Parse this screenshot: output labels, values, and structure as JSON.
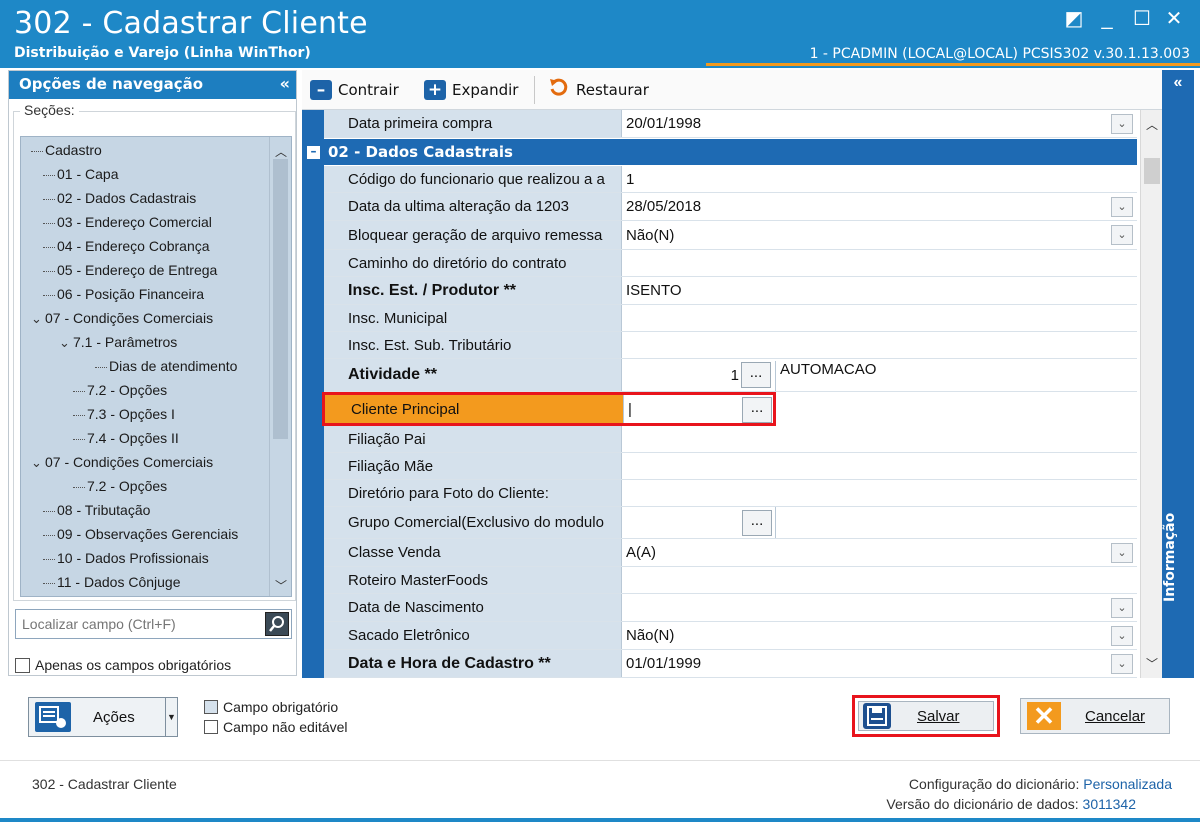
{
  "window": {
    "title": "302 - Cadastrar Cliente",
    "subtitle": "Distribuição e Varejo (Linha WinThor)",
    "user_info": "1 - PCADMIN (LOCAL@LOCAL)  PCSIS302  v.30.1.13.003",
    "controls": {
      "restore": "◩",
      "minimize": "_",
      "maximize": "☐",
      "close": "✕"
    }
  },
  "colors": {
    "title_bar": "#1e88c7",
    "panel_blue": "#1e6ab3",
    "highlight_orange": "#f39a1e",
    "highlight_border": "#e8141c"
  },
  "nav": {
    "header": "Opções de navegação",
    "collapse_glyph": "«",
    "sections_label": "Seções:",
    "items": [
      {
        "label": "Cadastro"
      },
      {
        "label": "01 - Capa"
      },
      {
        "label": "02 - Dados Cadastrais"
      },
      {
        "label": "03 - Endereço Comercial"
      },
      {
        "label": "04 - Endereço Cobrança"
      },
      {
        "label": "05 - Endereço de Entrega"
      },
      {
        "label": "06 - Posição Financeira"
      },
      {
        "label": "07 - Condições Comerciais"
      },
      {
        "label": "7.1 - Parâmetros"
      },
      {
        "label": "Dias de atendimento"
      },
      {
        "label": "7.2 - Opções"
      },
      {
        "label": "7.3 - Opções I"
      },
      {
        "label": "7.4 - Opções II"
      },
      {
        "label": "07 - Condições Comerciais"
      },
      {
        "label": "7.2 - Opções"
      },
      {
        "label": "08 - Tributação"
      },
      {
        "label": "09 - Observações Gerenciais"
      },
      {
        "label": "10 - Dados Profissionais"
      },
      {
        "label": "11 - Dados Cônjuge"
      }
    ],
    "search_placeholder": "Localizar campo (Ctrl+F)",
    "only_required_label": "Apenas os campos obrigatórios"
  },
  "toolbar": {
    "collapse_label": "Contrair",
    "expand_label": "Expandir",
    "restore_label": "Restaurar"
  },
  "grid": {
    "first_row": {
      "label": "Data primeira compra",
      "value": "20/01/1998"
    },
    "section_title": "02 - Dados Cadastrais",
    "rows": [
      {
        "label": "Código do funcionario que realizou a a",
        "value": "1"
      },
      {
        "label": "Data da ultima alteração da 1203",
        "value": "28/05/2018"
      },
      {
        "label": "Bloquear geração de arquivo remessa",
        "value": "Não(N)"
      },
      {
        "label": "Caminho do diretório do contrato",
        "value": ""
      },
      {
        "label": "Insc. Est. / Produtor **",
        "value": "ISENTO"
      },
      {
        "label": "Insc. Municipal",
        "value": ""
      },
      {
        "label": "Insc. Est. Sub. Tributário",
        "value": ""
      },
      {
        "label": "Atividade **",
        "value": "1",
        "extra": "AUTOMACAO"
      },
      {
        "label": "Cliente Principal",
        "value": "|"
      },
      {
        "label": "Filiação Pai",
        "value": ""
      },
      {
        "label": "Filiação Mãe",
        "value": ""
      },
      {
        "label": "Diretório para Foto do Cliente:",
        "value": ""
      },
      {
        "label": "Grupo Comercial(Exclusivo do modulo",
        "value": ""
      },
      {
        "label": "Classe Venda",
        "value": "A(A)"
      },
      {
        "label": "Roteiro MasterFoods",
        "value": ""
      },
      {
        "label": "Data de Nascimento",
        "value": ""
      },
      {
        "label": "Sacado Eletrônico",
        "value": "Não(N)"
      },
      {
        "label": "Data e Hora de Cadastro **",
        "value": "01/01/1999"
      }
    ],
    "ellipsis": "..."
  },
  "info_panel": {
    "label": "Informação",
    "collapse_glyph": "«"
  },
  "bottom": {
    "acoes_label": "Ações",
    "legend_required": "Campo obrigatório",
    "legend_readonly": "Campo não editável",
    "save_label": "Salvar",
    "cancel_label": "Cancelar"
  },
  "footer": {
    "left": "302 - Cadastrar Cliente",
    "config_label": "Configuração do dicionário:",
    "config_value": "Personalizada",
    "version_label": "Versão do dicionário de dados:",
    "version_value": "3011342"
  }
}
